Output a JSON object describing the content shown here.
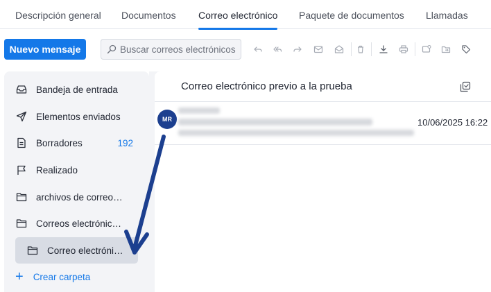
{
  "tabs": [
    {
      "label": "Descripción general",
      "active": false
    },
    {
      "label": "Documentos",
      "active": false
    },
    {
      "label": "Correo electrónico",
      "active": true
    },
    {
      "label": "Paquete de documentos",
      "active": false
    },
    {
      "label": "Llamadas",
      "active": false
    }
  ],
  "toolbar": {
    "new_message_label": "Nuevo mensaje",
    "search_placeholder": "Buscar correos electrónicos",
    "icons": [
      "reply-icon",
      "reply-all-icon",
      "forward-icon",
      "mark-read-icon",
      "mark-unread-icon",
      "delete-icon",
      "download-icon",
      "print-icon",
      "assign-icon",
      "move-icon",
      "tag-icon"
    ]
  },
  "sidebar": {
    "items": [
      {
        "label": "Bandeja de entrada",
        "icon": "inbox-icon",
        "count": ""
      },
      {
        "label": "Elementos enviados",
        "icon": "send-icon",
        "count": ""
      },
      {
        "label": "Borradores",
        "icon": "draft-icon",
        "count": "192"
      },
      {
        "label": "Realizado",
        "icon": "flag-icon",
        "count": ""
      },
      {
        "label": "archivos de correos…",
        "icon": "folder-icon",
        "count": ""
      },
      {
        "label": "Correos electrónico…",
        "icon": "folder-icon",
        "count": ""
      }
    ],
    "sub_item": {
      "label": "Correo electrónic…",
      "icon": "folder-icon",
      "selected": true
    },
    "create_folder_label": "Crear carpeta"
  },
  "main": {
    "title": "Correo electrónico previo a la prueba",
    "emails": [
      {
        "avatar_initials": "MR",
        "date": "10/06/2025 16:22"
      }
    ]
  },
  "colors": {
    "accent": "#1478e8",
    "avatar": "#1c3f8f",
    "annotation_arrow": "#1c3f8f",
    "sidebar_bg": "#f3f4f7",
    "selected_bg": "#d8dce4"
  }
}
